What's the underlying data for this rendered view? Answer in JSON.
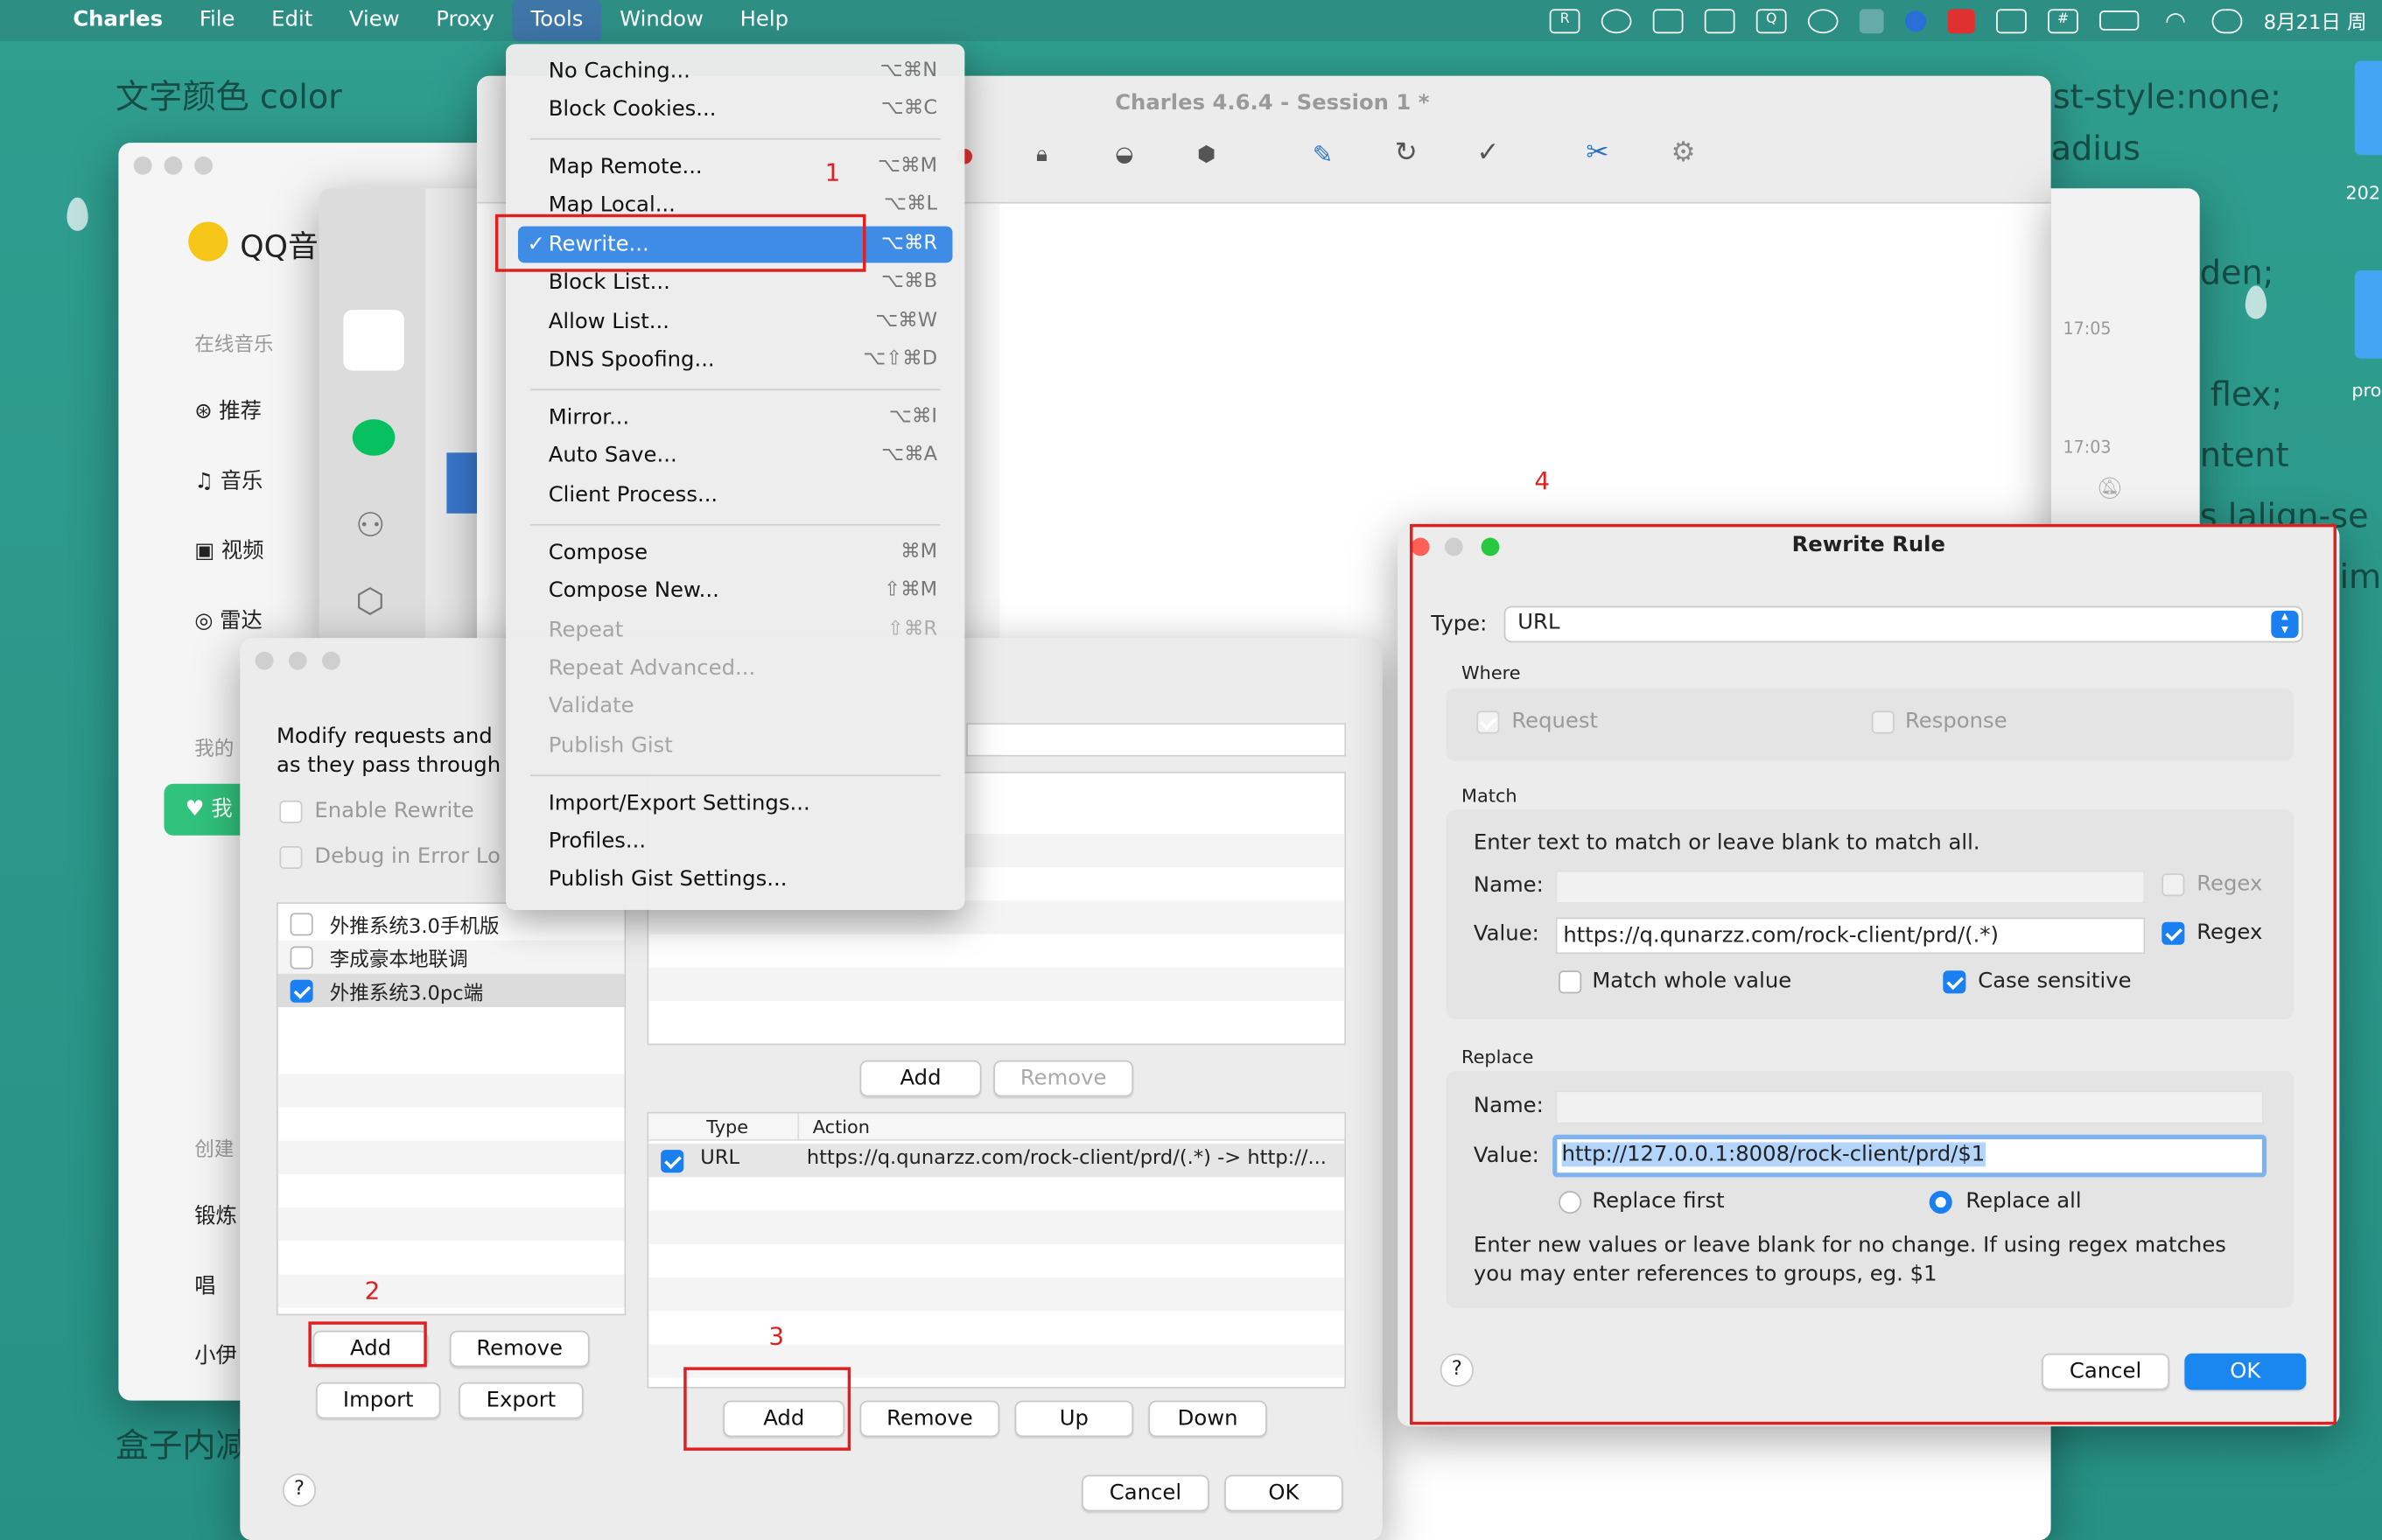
{
  "menubar": {
    "items": [
      "Charles",
      "File",
      "Edit",
      "View",
      "Proxy",
      "Tools",
      "Window",
      "Help"
    ],
    "active": "Tools",
    "clock": "8月21日 周",
    "tray_icons": [
      "r-icon",
      "chat-icon",
      "screen-icon",
      "grid-icon",
      "q-icon",
      "wechat-icon",
      "cat-icon",
      "feather-icon",
      "red-square-icon",
      "keyboard-icon",
      "hash-icon",
      "battery-icon",
      "wifi-icon",
      "control-center-icon"
    ]
  },
  "background_text": {
    "t1": "文字颜色 color",
    "t2": "大块列表同上 list-style:none;",
    "t3": "adius",
    "t4": "den;",
    "t5": "flex;",
    "t6": "ntent",
    "t7": "s lalign-se",
    "t8": "盒子内减",
    "t9": "im",
    "d1": "202",
    "d2": "pro"
  },
  "qq_music": {
    "logo": "QQ音",
    "section1": "在线音乐",
    "items": [
      "推荐",
      "音乐",
      "视频",
      "雷达"
    ],
    "section2": "我的",
    "my_items": [
      "我"
    ],
    "section3": "创建",
    "created": [
      "锻炼",
      "唱",
      "小伊"
    ]
  },
  "chat_window": {
    "time1": "17:05",
    "time2": "17:03"
  },
  "charles": {
    "title": "Charles 4.6.4 - Session 1 *"
  },
  "tools_menu": {
    "groups": [
      [
        {
          "label": "No Caching...",
          "shortcut": "⌥⌘N"
        },
        {
          "label": "Block Cookies...",
          "shortcut": "⌥⌘C"
        }
      ],
      [
        {
          "label": "Map Remote...",
          "shortcut": "⌥⌘M"
        },
        {
          "label": "Map Local...",
          "shortcut": "⌥⌘L"
        },
        {
          "label": "Rewrite...",
          "shortcut": "⌥⌘R",
          "checked": true
        },
        {
          "label": "Block List...",
          "shortcut": "⌥⌘B"
        },
        {
          "label": "Allow List...",
          "shortcut": "⌥⌘W"
        },
        {
          "label": "DNS Spoofing...",
          "shortcut": "⌥⇧⌘D"
        }
      ],
      [
        {
          "label": "Mirror...",
          "shortcut": "⌥⌘I"
        },
        {
          "label": "Auto Save...",
          "shortcut": "⌥⌘A"
        },
        {
          "label": "Client Process...",
          "shortcut": ""
        }
      ],
      [
        {
          "label": "Compose",
          "shortcut": "⌘M"
        },
        {
          "label": "Compose New...",
          "shortcut": "⇧⌘M"
        },
        {
          "label": "Repeat",
          "shortcut": "⇧⌘R",
          "disabled": true
        },
        {
          "label": "Repeat Advanced...",
          "shortcut": "",
          "disabled": true
        },
        {
          "label": "Validate",
          "shortcut": "",
          "disabled": true
        },
        {
          "label": "Publish Gist",
          "shortcut": "",
          "disabled": true
        }
      ],
      [
        {
          "label": "Import/Export Settings...",
          "shortcut": ""
        },
        {
          "label": "Profiles...",
          "shortcut": ""
        },
        {
          "label": "Publish Gist Settings...",
          "shortcut": ""
        }
      ]
    ],
    "checkmark": "✓"
  },
  "rewrite_settings": {
    "description": "Modify requests and\nas they pass through",
    "enable_label": "Enable Rewrite",
    "debug_label": "Debug in Error Lo",
    "sets": [
      {
        "label": "外推系统3.0手机版",
        "checked": false
      },
      {
        "label": "李成豪本地联调",
        "checked": false
      },
      {
        "label": "外推系统3.0pc端",
        "checked": true
      }
    ],
    "add": "Add",
    "remove": "Remove",
    "import": "Import",
    "export": "Export",
    "locations_add": "Add",
    "locations_remove": "Remove",
    "rules_headers": [
      "Type",
      "Action"
    ],
    "rules": [
      {
        "type": "URL",
        "action": "https://q.qunarzz.com/rock-client/prd/(.*) -> http://...",
        "checked": true
      }
    ],
    "rules_add": "Add",
    "rules_remove": "Remove",
    "rules_up": "Up",
    "rules_down": "Down",
    "cancel": "Cancel",
    "ok": "OK",
    "help": "?"
  },
  "rewrite_rule": {
    "title": "Rewrite Rule",
    "type_label": "Type:",
    "type_value": "URL",
    "where_label": "Where",
    "request_label": "Request",
    "response_label": "Response",
    "match_label": "Match",
    "match_hint": "Enter text to match or leave blank to match all.",
    "name_label": "Name:",
    "value_label": "Value:",
    "match_name": "",
    "match_value": "https://q.qunarzz.com/rock-client/prd/(.*)",
    "regex_label": "Regex",
    "match_whole_label": "Match whole value",
    "case_sensitive_label": "Case sensitive",
    "replace_label": "Replace",
    "replace_name": "",
    "replace_value": "http://127.0.0.1:8008/rock-client/prd/$1",
    "replace_first_label": "Replace first",
    "replace_all_label": "Replace all",
    "replace_hint": "Enter new values or leave blank for no change. If using regex matches\nyou may enter references to groups, eg. $1",
    "cancel": "Cancel",
    "ok": "OK",
    "help": "?"
  },
  "annotations": {
    "n1": "1",
    "n2": "2",
    "n3": "3",
    "n4": "4"
  },
  "colors": {
    "desktop": "#2a9d8f",
    "accent": "#1a7ff0",
    "annotation": "#e02020",
    "menu_highlight": "#3f8ce6"
  }
}
